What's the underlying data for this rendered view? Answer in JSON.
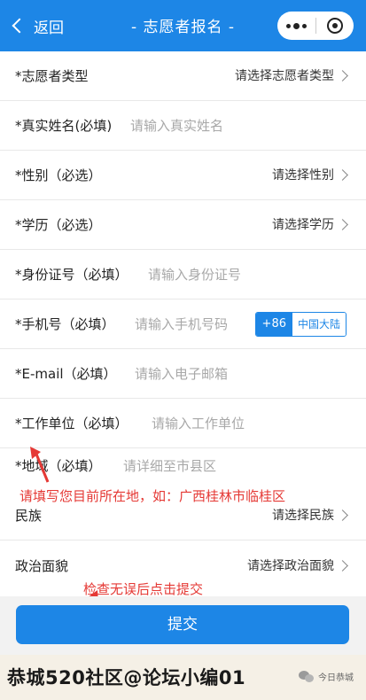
{
  "navbar": {
    "back_label": "返回",
    "title": "- 志愿者报名 -"
  },
  "form": {
    "volunteer_type": {
      "label": "*志愿者类型",
      "value": "请选择志愿者类型"
    },
    "real_name": {
      "label": "*真实姓名(必填)",
      "placeholder": "请输入真实姓名"
    },
    "gender": {
      "label": "*性别（必选）",
      "value": "请选择性别"
    },
    "education": {
      "label": "*学历（必选）",
      "value": "请选择学历"
    },
    "id_number": {
      "label": "*身份证号（必填）",
      "placeholder": "请输入身份证号"
    },
    "phone": {
      "label": "*手机号（必填）",
      "placeholder": "请输入手机号码",
      "country_code": "+86",
      "region": "中国大陆"
    },
    "email": {
      "label": "*E-mail（必填）",
      "placeholder": "请输入电子邮箱"
    },
    "employer": {
      "label": "*工作单位（必填）",
      "placeholder": "请输入工作单位"
    },
    "region": {
      "label": "*地域（必填）",
      "placeholder": "请详细至市县区"
    },
    "ethnicity": {
      "label": "民族",
      "value": "请选择民族"
    },
    "political_status": {
      "label": "政治面貌",
      "value": "请选择政治面貌"
    }
  },
  "annotations": {
    "region_hint": "请填写您目前所在地，如：广西桂林市临桂区",
    "submit_hint": "检查无误后点击提交"
  },
  "submit": {
    "label": "提交"
  },
  "footer": {
    "watermark": "恭城520社区@论坛小编01",
    "account": "今日恭城"
  },
  "colors": {
    "brand_blue": "#1d86e6",
    "annotation_red": "#e53935"
  }
}
